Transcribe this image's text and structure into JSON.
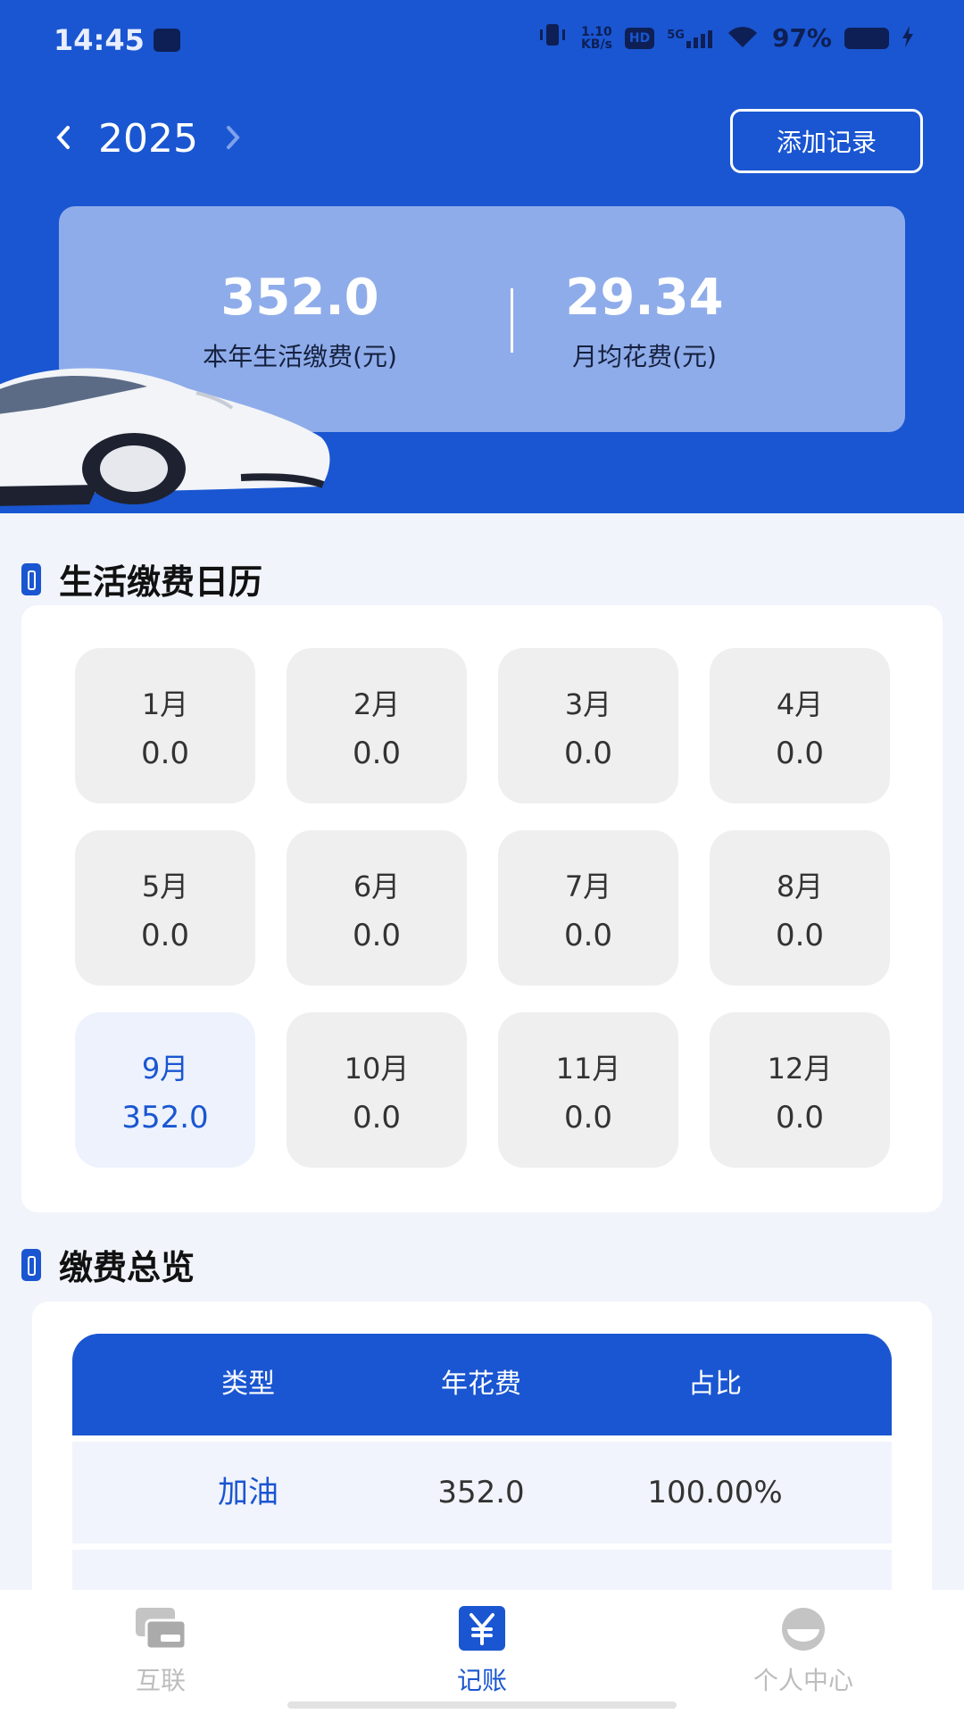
{
  "status": {
    "time": "14:45",
    "speed_top": "1.10",
    "speed_bottom": "KB/s",
    "hd": "HD",
    "network": "5G",
    "battery": "97%"
  },
  "header": {
    "year": "2025",
    "add_label": "添加记录"
  },
  "summary": {
    "annual_value": "352.0",
    "annual_label": "本年生活缴费(元)",
    "monthly_value": "29.34",
    "monthly_label": "月均花费(元)"
  },
  "calendar": {
    "title": "生活缴费日历",
    "months": [
      {
        "name": "1月",
        "value": "0.0"
      },
      {
        "name": "2月",
        "value": "0.0"
      },
      {
        "name": "3月",
        "value": "0.0"
      },
      {
        "name": "4月",
        "value": "0.0"
      },
      {
        "name": "5月",
        "value": "0.0"
      },
      {
        "name": "6月",
        "value": "0.0"
      },
      {
        "name": "7月",
        "value": "0.0"
      },
      {
        "name": "8月",
        "value": "0.0"
      },
      {
        "name": "9月",
        "value": "352.0"
      },
      {
        "name": "10月",
        "value": "0.0"
      },
      {
        "name": "11月",
        "value": "0.0"
      },
      {
        "name": "12月",
        "value": "0.0"
      }
    ]
  },
  "overview": {
    "title": "缴费总览",
    "headers": [
      "类型",
      "年花费",
      "占比"
    ],
    "rows": [
      {
        "type": "加油",
        "cost": "352.0",
        "ratio": "100.00%"
      }
    ]
  },
  "tabs": [
    {
      "label": "互联",
      "icon": "cards-icon"
    },
    {
      "label": "记账",
      "icon": "yuan-icon"
    },
    {
      "label": "个人中心",
      "icon": "profile-icon"
    }
  ],
  "colors": {
    "primary": "#1a56d1",
    "summary_card": "#8facea",
    "page_bg": "#f1f4fb"
  }
}
